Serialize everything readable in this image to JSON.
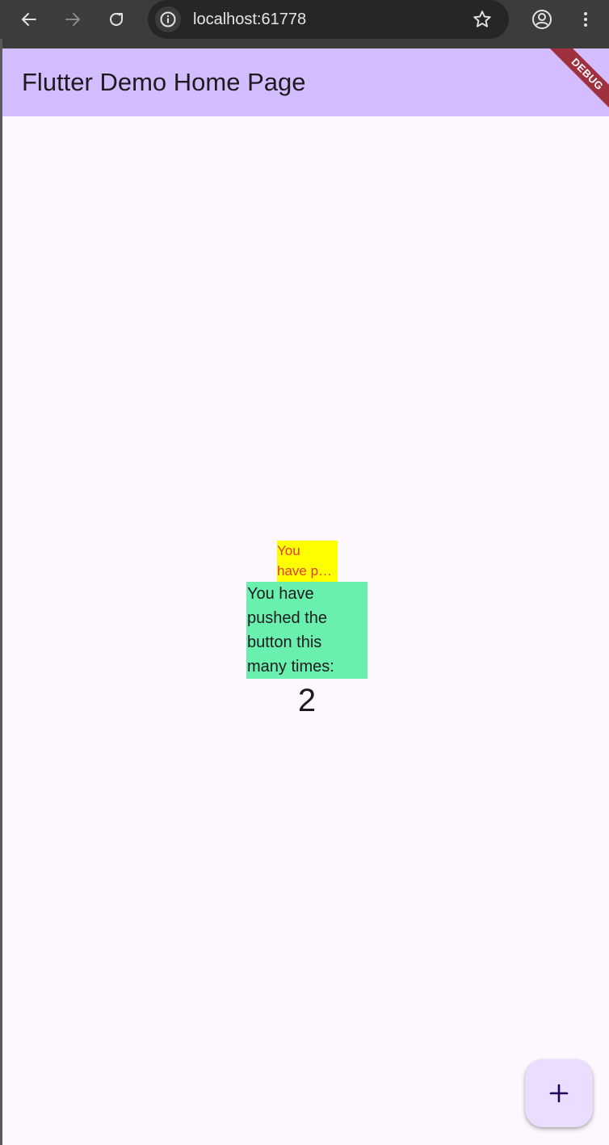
{
  "browser": {
    "url": "localhost:61778",
    "back_icon": "arrow-left-icon",
    "forward_icon": "arrow-right-icon",
    "reload_icon": "reload-icon",
    "info_icon": "info-icon",
    "bookmark_icon": "star-icon",
    "profile_icon": "profile-icon",
    "menu_icon": "more-vert-icon"
  },
  "appbar": {
    "title": "Flutter Demo Home Page",
    "debug_banner": "DEBUG",
    "color": "#d4bdfe"
  },
  "content": {
    "yellow_box": {
      "line1": "You",
      "line2": "have p…",
      "background": "#ffff00",
      "text_color": "#e53935"
    },
    "green_box": {
      "line1": "You have",
      "line2": "pushed the",
      "line3": "button this",
      "line4": "many times:",
      "background": "#69f0ae"
    },
    "counter": "2"
  },
  "fab": {
    "icon": "plus-icon",
    "background": "#eaddff"
  }
}
